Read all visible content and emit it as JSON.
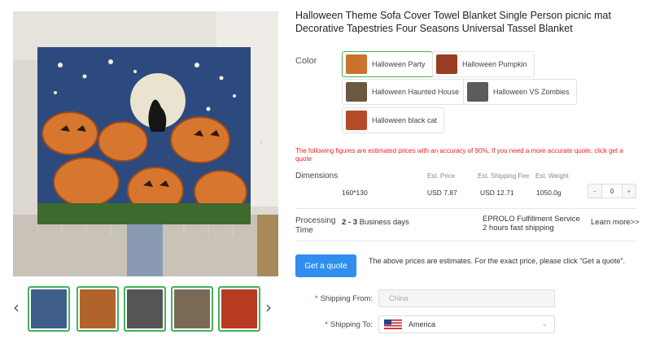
{
  "product": {
    "title": "Halloween Theme Sofa Cover Towel Blanket Single Person picnic mat Decorative Tapestries Four Seasons Universal Tassel Blanket"
  },
  "gallery": {
    "main_image": "halloween-blanket-photo",
    "thumbnails": [
      {
        "name": "thumb-1",
        "color": "#3e5d8a",
        "selected": true
      },
      {
        "name": "thumb-2",
        "color": "#b0642c",
        "selected": false
      },
      {
        "name": "thumb-3",
        "color": "#555555",
        "selected": false
      },
      {
        "name": "thumb-4",
        "color": "#7a6a55",
        "selected": false
      },
      {
        "name": "thumb-5",
        "color": "#b83a20",
        "selected": false
      }
    ]
  },
  "color_section": {
    "label": "Color",
    "options": [
      {
        "label": "Halloween Party",
        "swatch": "#c9732f",
        "selected": true
      },
      {
        "label": "Halloween Pumpkin",
        "swatch": "#9a3c24",
        "selected": false
      },
      {
        "label": "Halloween Haunted House",
        "swatch": "#6a5840",
        "selected": false
      },
      {
        "label": "Halloween VS Zombies",
        "swatch": "#5c5c5c",
        "selected": false
      },
      {
        "label": "Halloween black cat",
        "swatch": "#b44a2a",
        "selected": false
      }
    ]
  },
  "notice": "The following figures are estimated prices with an accuracy of 90%. If you need a more accurate quote, click get a quote",
  "pricing": {
    "dimensions_label": "Dimensions",
    "headers": {
      "price": "Est. Price",
      "shipping": "Est. Shipping Fee",
      "weight": "Est. Weight"
    },
    "row": {
      "size": "160*130",
      "price": "USD 7.87",
      "shipping": "USD 12.71",
      "weight": "1050.0g"
    },
    "quantity": {
      "minus": "−",
      "value": "0",
      "plus": "+"
    }
  },
  "processing": {
    "label": "Processing Time",
    "range": "2 - 3",
    "unit": "Business days",
    "service_line1": "EPROLO Fulfillment Service",
    "service_line2": "2 hours fast shipping",
    "learn_more": "Learn more>>"
  },
  "quote": {
    "button": "Get a quote",
    "note": "The above prices are estimates. For the exact price, please click \"Get a quote\"."
  },
  "shipping": {
    "required_mark": "*",
    "from_label": "Shipping From:",
    "from_value": "China",
    "to_label": "Shipping To:",
    "to_value": "America",
    "to_flag": "us-flag-icon"
  },
  "icons": {
    "prev": "‹",
    "next": "›",
    "chevron": "⌄"
  },
  "colors": {
    "accent_green": "#44b15a",
    "primary_blue": "#2f8ef0",
    "alert_red": "#ee2222"
  }
}
